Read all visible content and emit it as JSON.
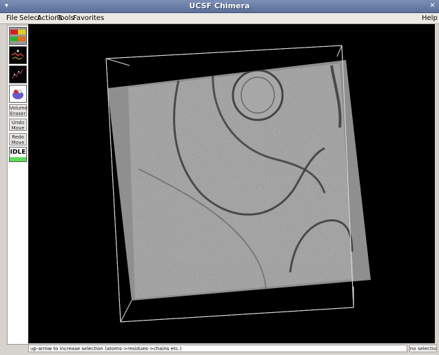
{
  "window": {
    "title": "UCSF Chimera"
  },
  "menubar": {
    "items": [
      "File",
      "Select",
      "Actions",
      "Tools",
      "Favorites"
    ],
    "help": "Help"
  },
  "toolbar": {
    "model_panel_icon": "model-panel-icon",
    "volume_eraser_label": "Volume Eraser",
    "undo_move_label": "Undo Move",
    "redo_move_label": "Redo Move",
    "idle_label": "IDLE",
    "idle_color": "#5fdc5a"
  },
  "status": {
    "message": "up-arrow to increase selection (atoms->residues->chains etc.)",
    "selection": "no selection"
  }
}
